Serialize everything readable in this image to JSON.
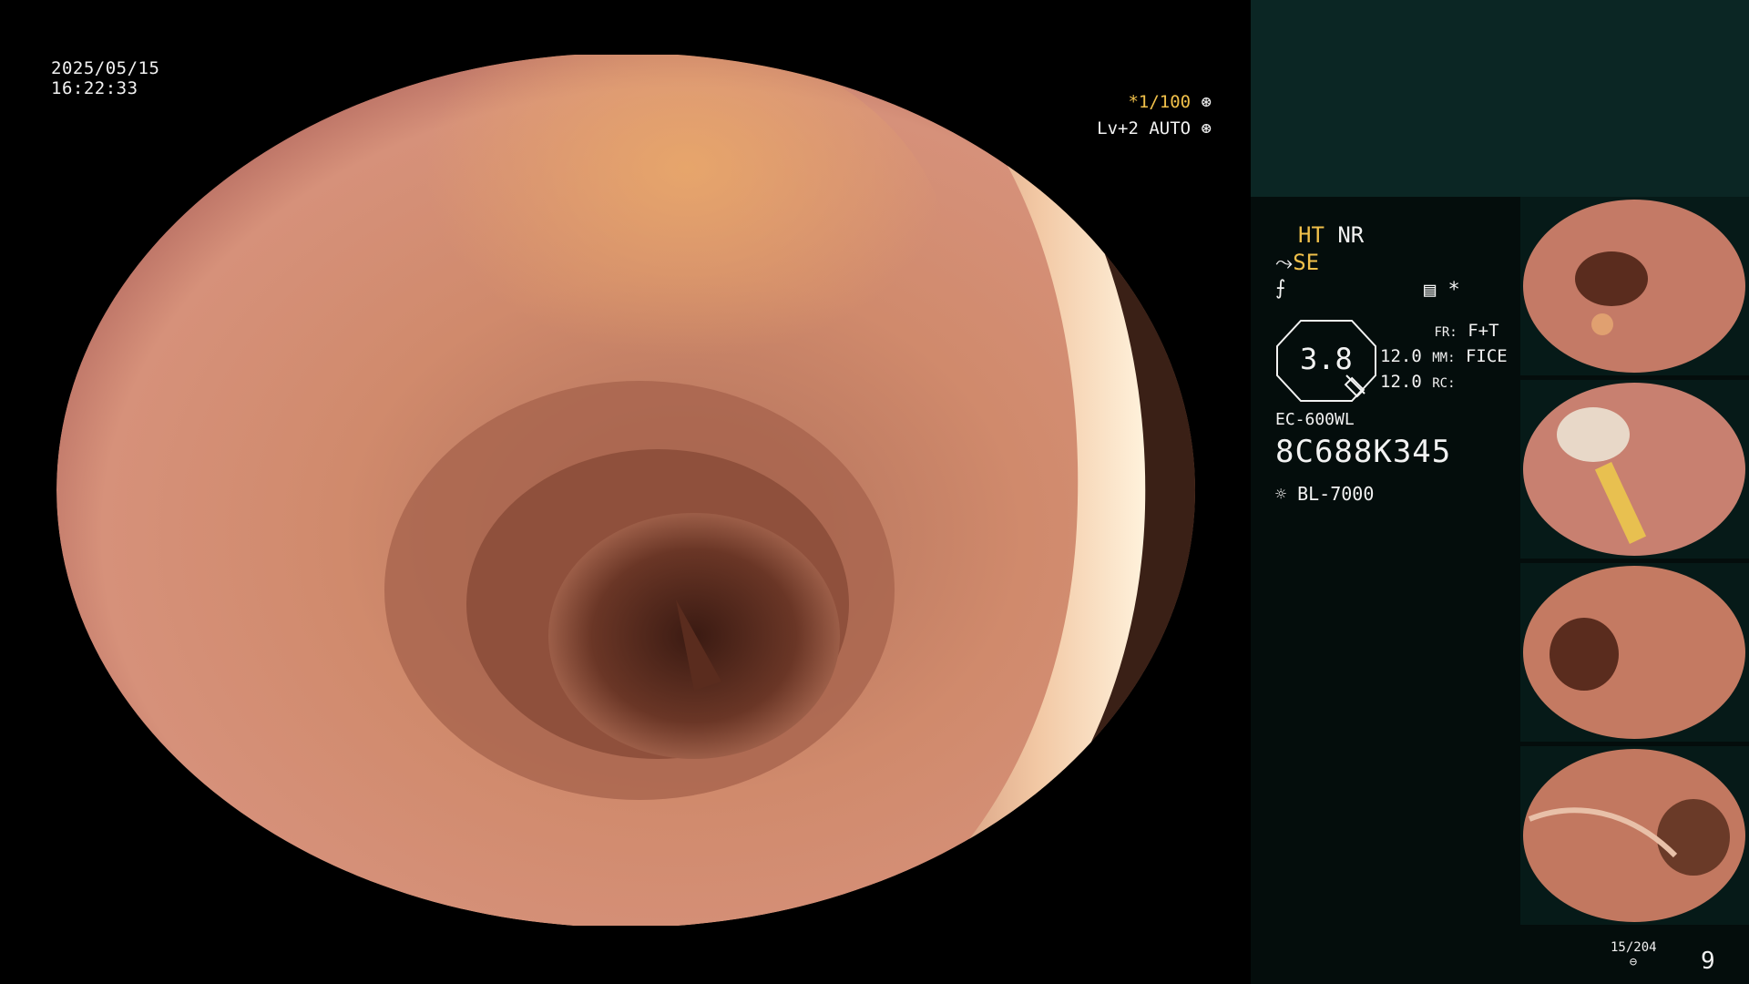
{
  "overlay": {
    "date": "2025/05/15",
    "time": "16:22:33",
    "shutter": "*1/100",
    "level": "Lv+2 AUTO"
  },
  "side_panel": {
    "mode_ht": "HT",
    "mode_nr": "NR",
    "mode_se": "SE",
    "zoom": "3.8",
    "values": [
      "12.0",
      "12.0"
    ],
    "fr_label": "FR:",
    "fr_value": "F+T",
    "mm_label": "MM:",
    "mm_value": "FICE",
    "rc_label": "RC:",
    "scope_model": "EC-600WL",
    "scope_serial": "8C688K345",
    "light_source": "BL-7000",
    "counter": "15/204",
    "page": "9"
  },
  "icons": {
    "shutter_icon": "aperture-icon",
    "auto_icon": "iris-icon",
    "light_icon": "sun-icon"
  }
}
